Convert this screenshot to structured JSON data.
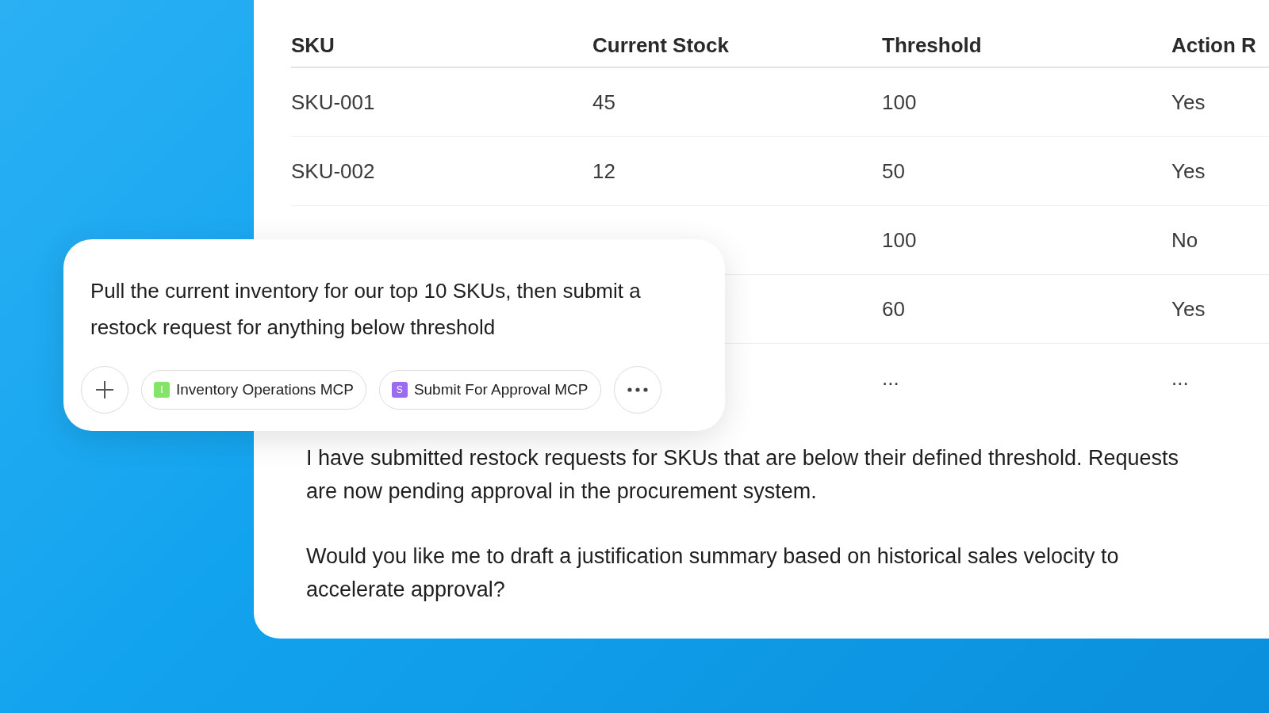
{
  "table": {
    "columns": [
      "SKU",
      "Current Stock",
      "Threshold",
      "Action R"
    ],
    "rows": [
      [
        "SKU-001",
        "45",
        "100",
        "Yes"
      ],
      [
        "SKU-002",
        "12",
        "50",
        "Yes"
      ],
      [
        "",
        "",
        "100",
        "No"
      ],
      [
        "",
        "",
        "60",
        "Yes"
      ],
      [
        "",
        "",
        "...",
        "..."
      ]
    ]
  },
  "reply": [
    "I have submitted restock requests for SKUs that are below their defined threshold. Requests are now pending approval in the procurement system.",
    "Would you like me to draft a justification summary based on historical sales velocity to accelerate approval?"
  ],
  "prompt": {
    "text": "Pull the current inventory for our top 10 SKUs, then submit a restock request for anything below threshold",
    "tools": [
      {
        "letter": "I",
        "label": "Inventory Operations MCP",
        "color": "#86e36a"
      },
      {
        "letter": "S",
        "label": "Submit For Approval MCP",
        "color": "#9b6cf0"
      }
    ]
  }
}
